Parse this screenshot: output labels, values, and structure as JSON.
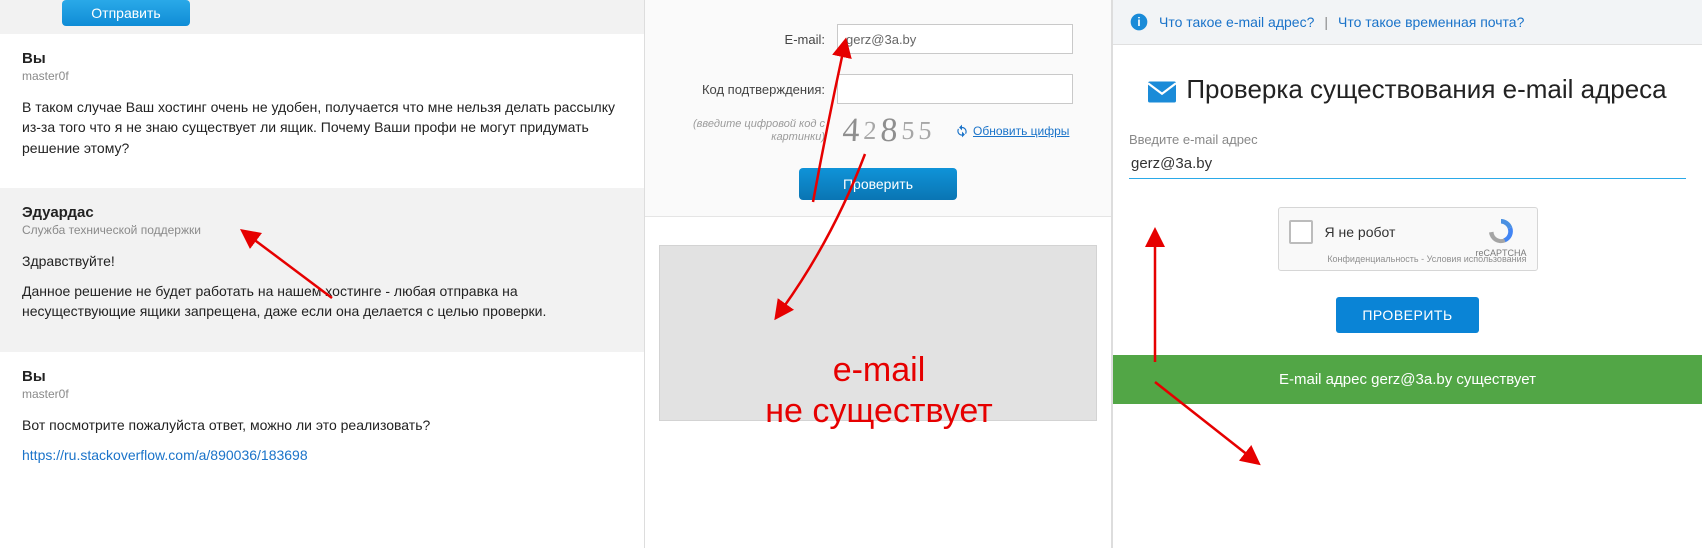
{
  "left": {
    "send_label": "Отправить",
    "msgs": [
      {
        "author": "Вы",
        "sub": "master0f",
        "body1": "В таком случае Ваш хостинг очень не удобен, получается что мне нельзя делать рассылку из-за того что я не знаю существует ли ящик. Почему Ваши профи не могут придумать решение этому?"
      },
      {
        "author": "Эдуардас",
        "sub": "Служба технической поддержки",
        "greet": "Здравствуйте!",
        "body1": "Данное решение не будет работать на нашем хостинге - любая отправка на несуществующие ящики запрещена, даже если она делается с целью проверки."
      },
      {
        "author": "Вы",
        "sub": "master0f",
        "body1": "Вот посмотрите пожалуйста ответ, можно ли это реализовать?",
        "link": "https://ru.stackoverflow.com/a/890036/183698"
      }
    ]
  },
  "mid": {
    "email_label": "E-mail:",
    "email_value": "gerz@3a.by",
    "code_label": "Код подтверждения:",
    "code_hint": "(введите цифровой код с картинки)",
    "captcha_digits": "42855",
    "refresh_label": "Обновить цифры",
    "check_label": "Проверить",
    "overlay_line1": "e-mail",
    "overlay_line2": "не существует"
  },
  "right": {
    "help1": "Что такое e-mail адрес?",
    "help2": "Что такое временная почта?",
    "title": "Проверка существования e-mail адреса",
    "input_label": "Введите e-mail адрес",
    "input_value": "gerz@3a.by",
    "recaptcha_label": "Я не робот",
    "recaptcha_brand": "reCAPTCHA",
    "recaptcha_foot": "Конфиденциальность - Условия использования",
    "check_label": "ПРОВЕРИТЬ",
    "result": "E-mail адрес gerz@3a.by существует"
  }
}
